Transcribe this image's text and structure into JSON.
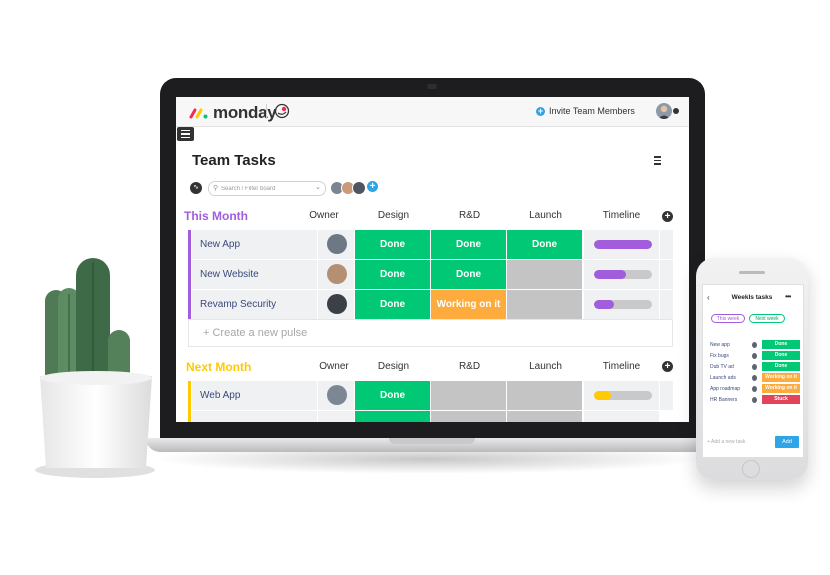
{
  "app": {
    "logo_text": "monday",
    "invite_label": "Invite Team Members"
  },
  "board": {
    "title": "Team Tasks",
    "search_placeholder": "Search / Filter board",
    "new_pulse_placeholder": "+ Create a new pulse"
  },
  "columns": {
    "owner": "Owner",
    "design": "Design",
    "rnd": "R&D",
    "launch": "Launch",
    "timeline": "Timeline"
  },
  "groups": [
    {
      "title": "This Month",
      "color": "#a25ddc",
      "rows": [
        {
          "name": "New App",
          "design": "Done",
          "rnd": "Done",
          "launch": "Done",
          "timeline_progress": 1.0
        },
        {
          "name": "New Website",
          "design": "Done",
          "rnd": "Done",
          "launch": "",
          "timeline_progress": 0.55
        },
        {
          "name": "Revamp Security",
          "design": "Done",
          "rnd": "Working on it",
          "launch": "",
          "timeline_progress": 0.35
        }
      ]
    },
    {
      "title": "Next Month",
      "color": "#ffcb00",
      "rows": [
        {
          "name": "Web App",
          "design": "Done",
          "rnd": "",
          "launch": "",
          "timeline_progress": 0.3
        }
      ]
    }
  ],
  "colors": {
    "done": "#00c875",
    "working": "#fdab3d",
    "stuck": "#e2445c",
    "empty": "#c4c4c4",
    "purple": "#a25ddc",
    "yellow": "#ffcb00",
    "accent_blue": "#2ea5e6"
  },
  "phone": {
    "title": "Weekls tasks",
    "tab_active": "This week",
    "tab_other": "Next week",
    "rows": [
      {
        "name": "New app",
        "status": "Done"
      },
      {
        "name": "Fix bugs",
        "status": "Done"
      },
      {
        "name": "Dub TV ad",
        "status": "Done"
      },
      {
        "name": "Launch ads",
        "status": "Working on it"
      },
      {
        "name": "App roadmap",
        "status": "Working on it"
      },
      {
        "name": "HR Banners",
        "status": "Stuck"
      }
    ],
    "add_placeholder": "+ Add a new task",
    "add_button": "Add"
  },
  "icons": {
    "menu": "hamburger-icon",
    "board_menu": "board-menu-icon",
    "activity": "activity-icon",
    "search": "search-icon",
    "add_column": "plus-icon",
    "invite": "plus-circle-icon"
  }
}
